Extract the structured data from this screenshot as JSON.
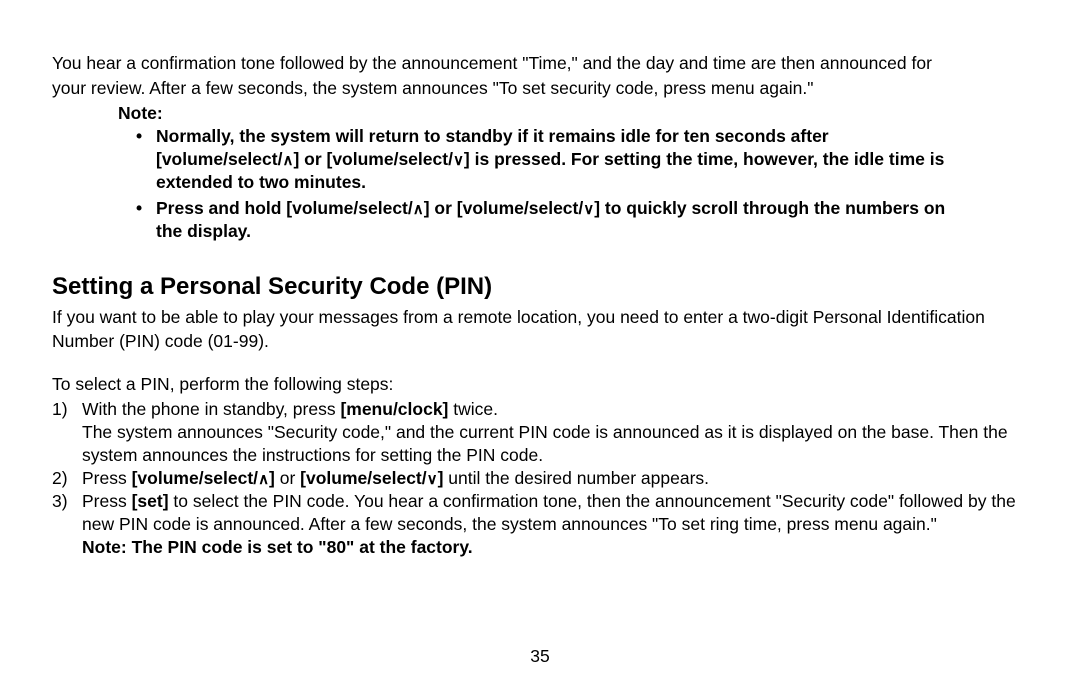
{
  "intro": {
    "p1a": "You hear a confirmation tone followed by the announcement \"Time,\" and the day and time are then announced for",
    "p1b": "your review. After a few seconds, the system announces \"To set security code, press menu again.\""
  },
  "note": {
    "label": "Note:",
    "b1a": "Normally, the system will return to standby if it remains idle for ten seconds after",
    "b1b_pre": "[volume/select/",
    "b1b_mid": "] or [volume/select/",
    "b1b_post": "] is pressed. For setting the time, however, the idle time is",
    "b1c": "extended to two minutes.",
    "b2a_pre": "Press and hold [volume/select/",
    "b2a_mid": "] or [volume/select/",
    "b2a_post": "] to quickly scroll through the numbers on",
    "b2b": "the display."
  },
  "heading": "Setting a Personal Security Code (PIN)",
  "body": {
    "p1": "If you want to be able to play your messages from a remote location, you need to enter a two-digit Personal Identification Number (PIN) code (01-99).",
    "p2": "To select a PIN, perform the following steps:"
  },
  "steps": {
    "s1": {
      "num": "1)",
      "t1a": "With the phone in standby, press ",
      "t1b_bold": "[menu/clock]",
      "t1c": " twice.",
      "t2": "The system announces \"Security code,\" and the current PIN code is announced as it is displayed on the base. Then the system announces the instructions for setting the PIN code."
    },
    "s2": {
      "num": "2)",
      "pre": "Press ",
      "part1_pre": "[volume/select/",
      "or": " or ",
      "part2_pre": "[volume/select/",
      "close": "]",
      "post": " until the desired number appears."
    },
    "s3": {
      "num": "3)",
      "pre": "Press ",
      "set": "[set]",
      "post": " to select the PIN code. You hear a confirmation tone, then the announcement \"Security code\" followed by the new PIN code is announced. After a few seconds, the system announces \"To set ring time, press menu again.\""
    },
    "factory_note": "Note: The PIN code is set to \"80\" at the factory."
  },
  "page_number": "35",
  "icons": {
    "up": "∧",
    "down": "∨"
  }
}
